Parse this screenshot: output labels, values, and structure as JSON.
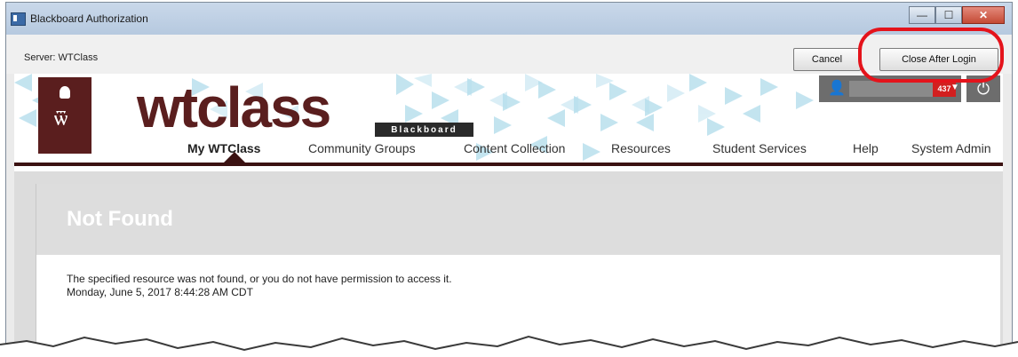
{
  "window": {
    "title": "Blackboard Authorization",
    "controls": {
      "minimize": "—",
      "maximize": "☐",
      "close": "✕"
    }
  },
  "toolbar": {
    "server_label": "Server: WTClass",
    "cancel_label": "Cancel",
    "close_after_login_label": "Close After Login"
  },
  "header": {
    "brand": "wtclass",
    "tag": "Blackboard",
    "user": {
      "notification_count": "437"
    },
    "power_icon": "power-icon"
  },
  "nav": {
    "items": [
      {
        "label": "My WTClass"
      },
      {
        "label": "Community Groups"
      },
      {
        "label": "Content Collection"
      },
      {
        "label": "Resources"
      },
      {
        "label": "Student Services"
      },
      {
        "label": "Help"
      },
      {
        "label": "System Admin"
      }
    ]
  },
  "content": {
    "title": "Not Found",
    "message": "The specified resource was not found, or you do not have permission to access it.",
    "timestamp": "Monday, June 5, 2017 8:44:28 AM CDT"
  },
  "colors": {
    "brand": "#5a1e1e",
    "highlight": "#e4131b",
    "badge": "#d21f1f"
  }
}
